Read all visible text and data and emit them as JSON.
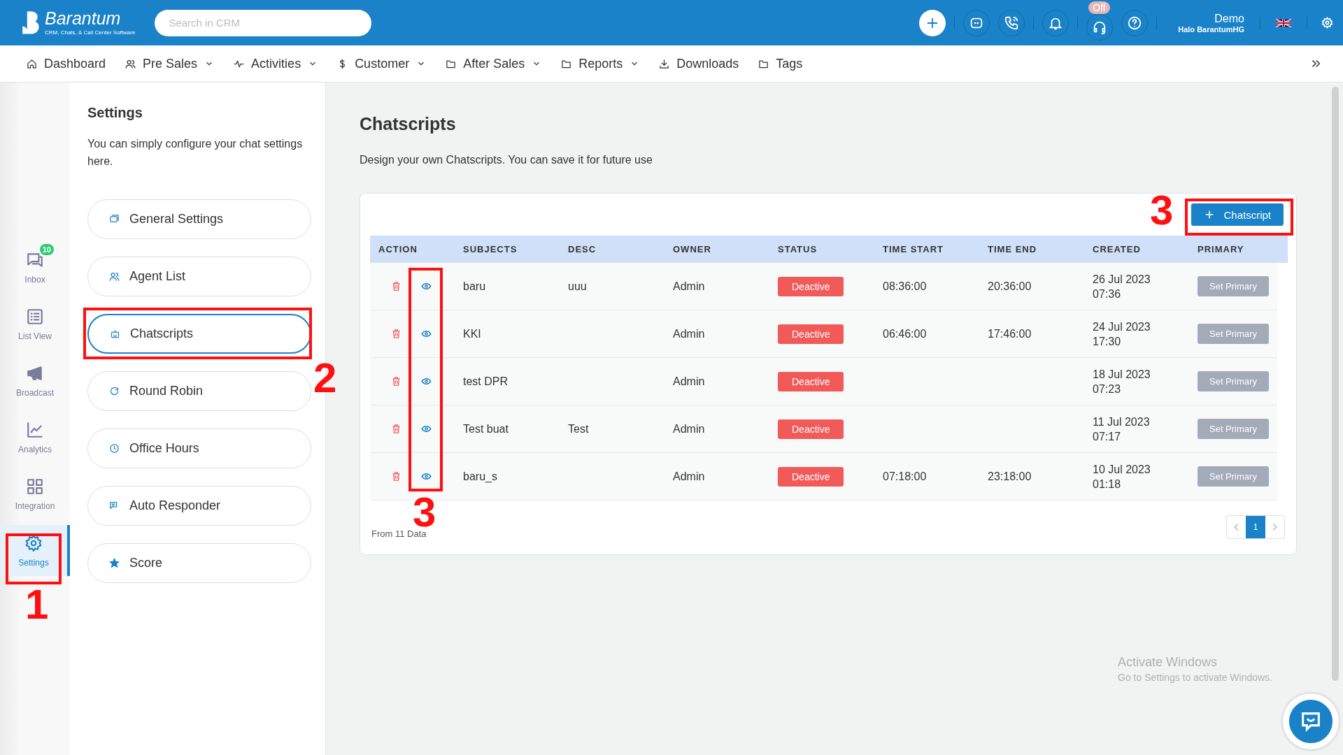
{
  "brand": {
    "name": "Barantum",
    "tagline": "CRM, Chats, & Call Center Software"
  },
  "search": {
    "placeholder": "Search in CRM"
  },
  "header": {
    "status_badge": "Off",
    "user_name": "Demo",
    "user_company": "Halo BarantumHG"
  },
  "nav": [
    {
      "label": "Dashboard",
      "dropdown": false
    },
    {
      "label": "Pre Sales",
      "dropdown": true
    },
    {
      "label": "Activities",
      "dropdown": true
    },
    {
      "label": "Customer",
      "dropdown": true
    },
    {
      "label": "After Sales",
      "dropdown": true
    },
    {
      "label": "Reports",
      "dropdown": true
    },
    {
      "label": "Downloads",
      "dropdown": false
    },
    {
      "label": "Tags",
      "dropdown": false
    }
  ],
  "rail": [
    {
      "label": "Inbox",
      "badge": "10",
      "selected": false
    },
    {
      "label": "List View",
      "selected": false
    },
    {
      "label": "Broadcast",
      "selected": false
    },
    {
      "label": "Analytics",
      "selected": false
    },
    {
      "label": "Integration",
      "selected": false
    },
    {
      "label": "Settings",
      "selected": true
    }
  ],
  "settings": {
    "title": "Settings",
    "description": "You can simply configure your chat settings here.",
    "items": [
      {
        "label": "General Settings",
        "selected": false
      },
      {
        "label": "Agent List",
        "selected": false
      },
      {
        "label": "Chatscripts",
        "selected": true
      },
      {
        "label": "Round Robin",
        "selected": false
      },
      {
        "label": "Office Hours",
        "selected": false
      },
      {
        "label": "Auto Responder",
        "selected": false
      },
      {
        "label": "Score",
        "selected": false
      }
    ]
  },
  "page": {
    "title": "Chatscripts",
    "subtitle": "Design your own Chatscripts. You can save it for future use",
    "add_button": "Chatscript"
  },
  "table": {
    "columns": [
      "ACTION",
      "SUBJECTS",
      "DESC",
      "OWNER",
      "STATUS",
      "TIME START",
      "TIME END",
      "CREATED",
      "PRIMARY"
    ],
    "rows": [
      {
        "subject": "baru",
        "desc": "uuu",
        "owner": "Admin",
        "status": "Deactive",
        "time_start": "08:36:00",
        "time_end": "20:36:00",
        "created": "26 Jul 2023\n07:36",
        "primary": "Set Primary"
      },
      {
        "subject": "KKI",
        "owner": "Admin",
        "status": "Deactive",
        "time_start": "06:46:00",
        "time_end": "17:46:00",
        "created": "24 Jul 2023\n17:30",
        "primary": "Set Primary"
      },
      {
        "subject": "test DPR",
        "owner": "Admin",
        "status": "Deactive",
        "created": "18 Jul 2023\n07:23",
        "primary": "Set Primary"
      },
      {
        "subject": "Test buat",
        "desc": "Test",
        "owner": "Admin",
        "status": "Deactive",
        "created": "11 Jul 2023\n07:17",
        "primary": "Set Primary"
      },
      {
        "subject": "baru_s",
        "owner": "Admin",
        "status": "Deactive",
        "time_start": "07:18:00",
        "time_end": "23:18:00",
        "created": "10 Jul 2023\n01:18",
        "primary": "Set Primary"
      }
    ]
  },
  "footer": {
    "count": "From 11 Data",
    "pages": [
      {
        "label": "1",
        "selected": true
      }
    ]
  },
  "os_notice": {
    "title": "Activate Windows",
    "text": "Go to Settings to activate Windows."
  },
  "annotations": [
    "1",
    "2",
    "3",
    "3"
  ]
}
